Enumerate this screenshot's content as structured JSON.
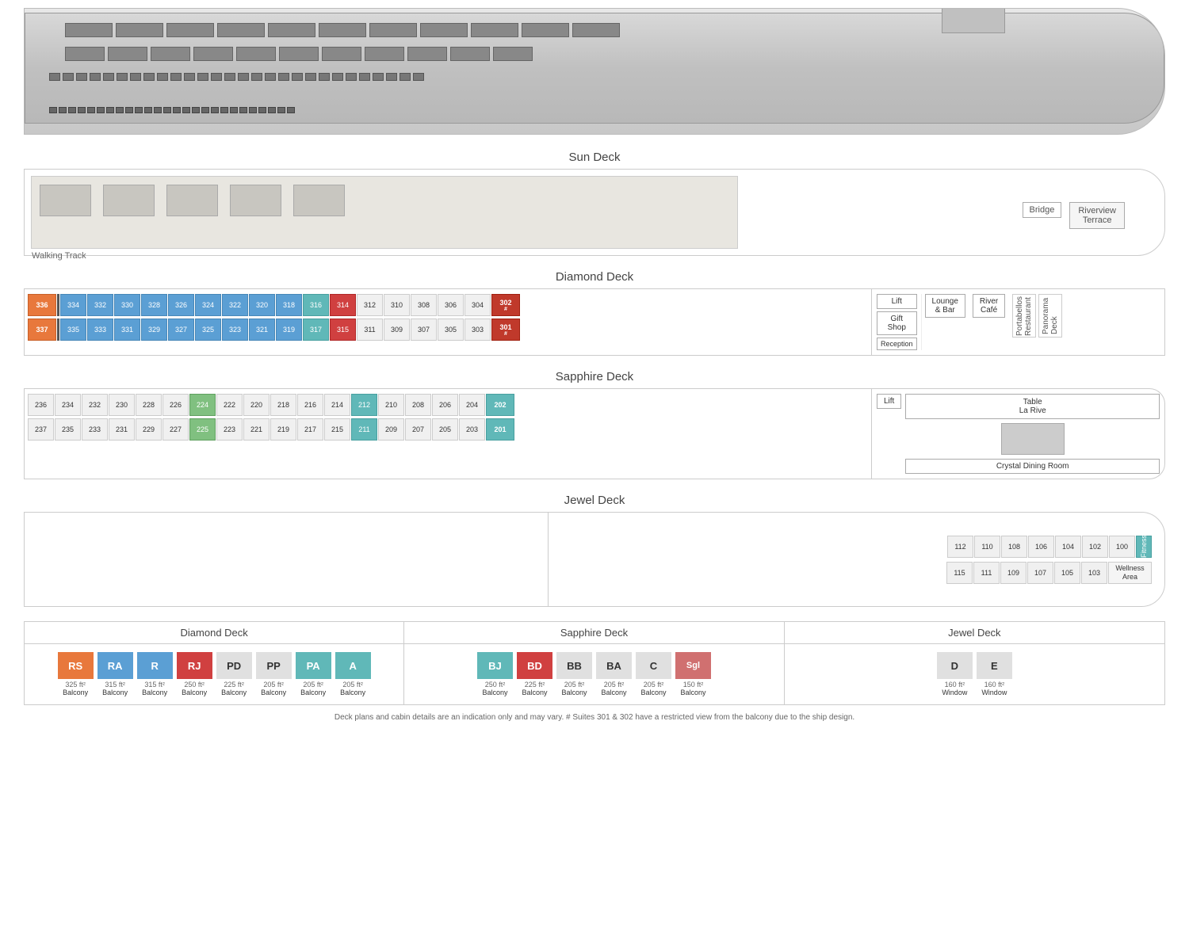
{
  "ship": {
    "image_alt": "River cruise ship"
  },
  "decks": {
    "sun": {
      "title": "Sun Deck",
      "walking_track": "Walking Track",
      "bridge": "Bridge",
      "riverview_terrace": "Riverview\nTerrace"
    },
    "diamond": {
      "title": "Diamond Deck",
      "facilities": {
        "lift": "Lift",
        "gift_shop": "Gift\nShop",
        "lounge_bar": "Lounge\n& Bar",
        "reception": "Reception",
        "river_cafe": "River\nCafé",
        "portabellos": "Portabellos\nRestaurant",
        "panorama_deck": "Panorama\nDeck"
      },
      "upper_row": [
        "336",
        "334",
        "332",
        "330",
        "328",
        "326",
        "324",
        "322",
        "320",
        "318",
        "316",
        "314",
        "312",
        "310",
        "308",
        "306",
        "304",
        "302"
      ],
      "lower_row": [
        "337",
        "335",
        "333",
        "331",
        "329",
        "327",
        "325",
        "323",
        "321",
        "319",
        "317",
        "315",
        "311",
        "309",
        "307",
        "305",
        "303",
        "301"
      ]
    },
    "sapphire": {
      "title": "Sapphire Deck",
      "facilities": {
        "lift": "Lift",
        "table_la_rive": "Table\nLa Rive",
        "crystal_dining": "Crystal Dining Room"
      },
      "upper_row": [
        "236",
        "234",
        "232",
        "230",
        "228",
        "226",
        "224",
        "222",
        "220",
        "218",
        "216",
        "214",
        "212",
        "210",
        "208",
        "206",
        "204",
        "202"
      ],
      "lower_row": [
        "237",
        "235",
        "233",
        "231",
        "229",
        "227",
        "225",
        "223",
        "221",
        "219",
        "217",
        "215",
        "211",
        "209",
        "207",
        "205",
        "203",
        "201"
      ]
    },
    "jewel": {
      "title": "Jewel Deck",
      "upper_row": [
        "112",
        "110",
        "108",
        "106",
        "104",
        "102",
        "100"
      ],
      "lower_row": [
        "115",
        "111",
        "109",
        "107",
        "105",
        "103"
      ],
      "fitness": "Fitness",
      "wellness": "Wellness\nArea"
    }
  },
  "legend": {
    "diamond_deck_title": "Diamond Deck",
    "sapphire_deck_title": "Sapphire Deck",
    "jewel_deck_title": "Jewel Deck",
    "items": {
      "RS": {
        "code": "RS",
        "size": "325 ft²",
        "type": "Balcony",
        "color": "#e8783c"
      },
      "RA": {
        "code": "RA",
        "size": "315 ft²",
        "type": "Balcony",
        "color": "#5b9fd4"
      },
      "R": {
        "code": "R",
        "size": "315 ft²",
        "type": "Balcony",
        "color": "#5b9fd4"
      },
      "RJ": {
        "code": "RJ",
        "size": "250 ft²",
        "type": "Balcony",
        "color": "#d04040"
      },
      "PD": {
        "code": "PD",
        "size": "225 ft²",
        "type": "Balcony",
        "color": "#e0e0e0"
      },
      "PP": {
        "code": "PP",
        "size": "205 ft²",
        "type": "Balcony",
        "color": "#e0e0e0"
      },
      "PA": {
        "code": "PA",
        "size": "205 ft²",
        "type": "Balcony",
        "color": "#60b8b8"
      },
      "A": {
        "code": "A",
        "size": "205 ft²",
        "type": "Balcony",
        "color": "#60b8b8"
      },
      "BJ": {
        "code": "BJ",
        "size": "250 ft²",
        "type": "Balcony",
        "color": "#60b8b8"
      },
      "BD": {
        "code": "BD",
        "size": "225 ft²",
        "type": "Balcony",
        "color": "#d04040"
      },
      "BB": {
        "code": "BB",
        "size": "205 ft²",
        "type": "Balcony",
        "color": "#e0e0e0"
      },
      "BA": {
        "code": "BA",
        "size": "205 ft²",
        "type": "Balcony",
        "color": "#e0e0e0"
      },
      "C": {
        "code": "C",
        "size": "205 ft²",
        "type": "Balcony",
        "color": "#e0e0e0"
      },
      "Sgl": {
        "code": "Sgl",
        "size": "150 ft²",
        "type": "Balcony",
        "color": "#d07070"
      },
      "D": {
        "code": "D",
        "size": "160 ft²",
        "type": "Window",
        "color": "#e0e0e0"
      },
      "E": {
        "code": "E",
        "size": "160 ft²",
        "type": "Window",
        "color": "#e0e0e0"
      }
    }
  },
  "footnote": "Deck plans and cabin details are an indication only and may vary.  # Suites 301 & 302 have a restricted view from the balcony due to the ship design."
}
